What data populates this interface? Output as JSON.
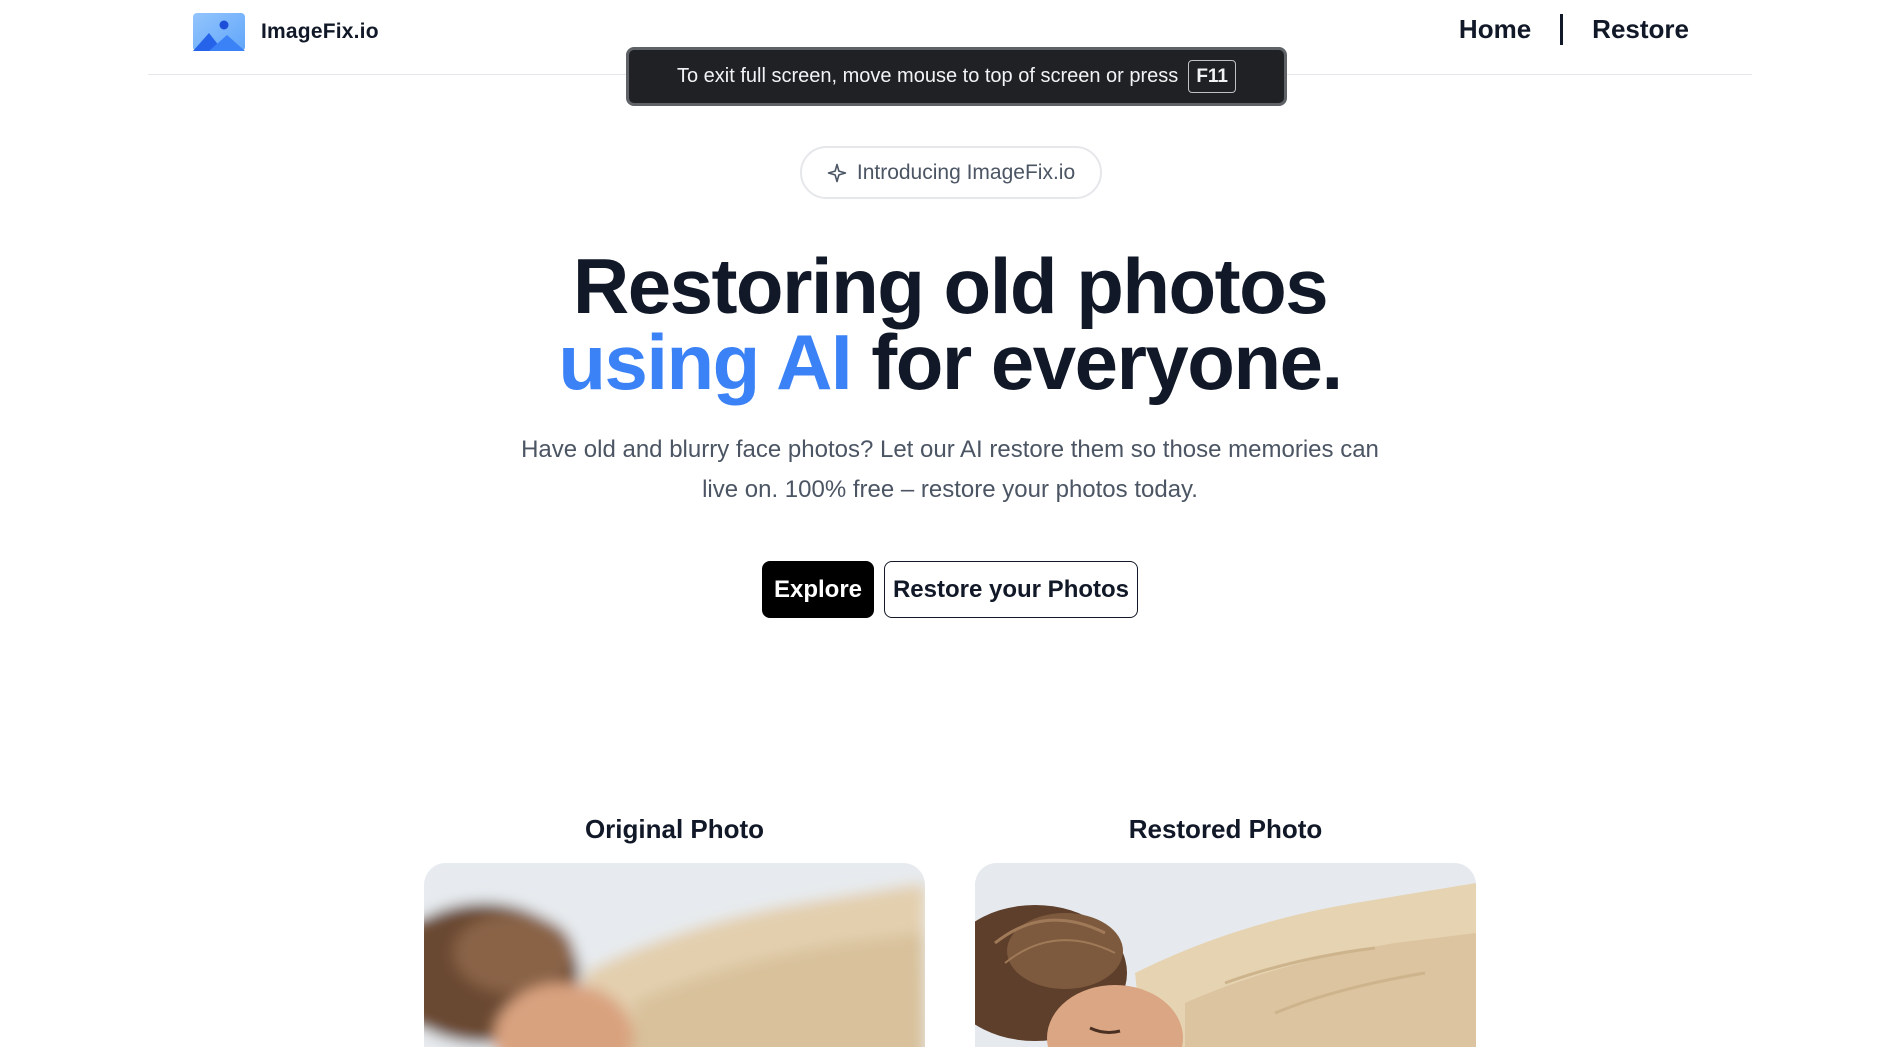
{
  "brand": {
    "name": "ImageFix.io",
    "logo_icon": "image-landscape-icon",
    "logo_color": "#3b82f6"
  },
  "nav": {
    "home": "Home",
    "restore": "Restore"
  },
  "fullscreen_toast": {
    "message": "To exit full screen, move mouse to top of screen or press",
    "key": "F11"
  },
  "intro_pill": {
    "icon": "sparkle-icon",
    "label": "Introducing ImageFix.io"
  },
  "hero": {
    "title_line1": "Restoring old photos",
    "title_accent": "using AI",
    "title_rest": "for everyone.",
    "subtitle": "Have old and blurry face photos? Let our AI restore them so those memories can live on. 100% free – restore your photos today.",
    "accent_color": "#3b82f6"
  },
  "buttons": {
    "explore": "Explore",
    "restore_photos": "Restore your Photos"
  },
  "comparison": {
    "original_label": "Original Photo",
    "restored_label": "Restored Photo"
  }
}
